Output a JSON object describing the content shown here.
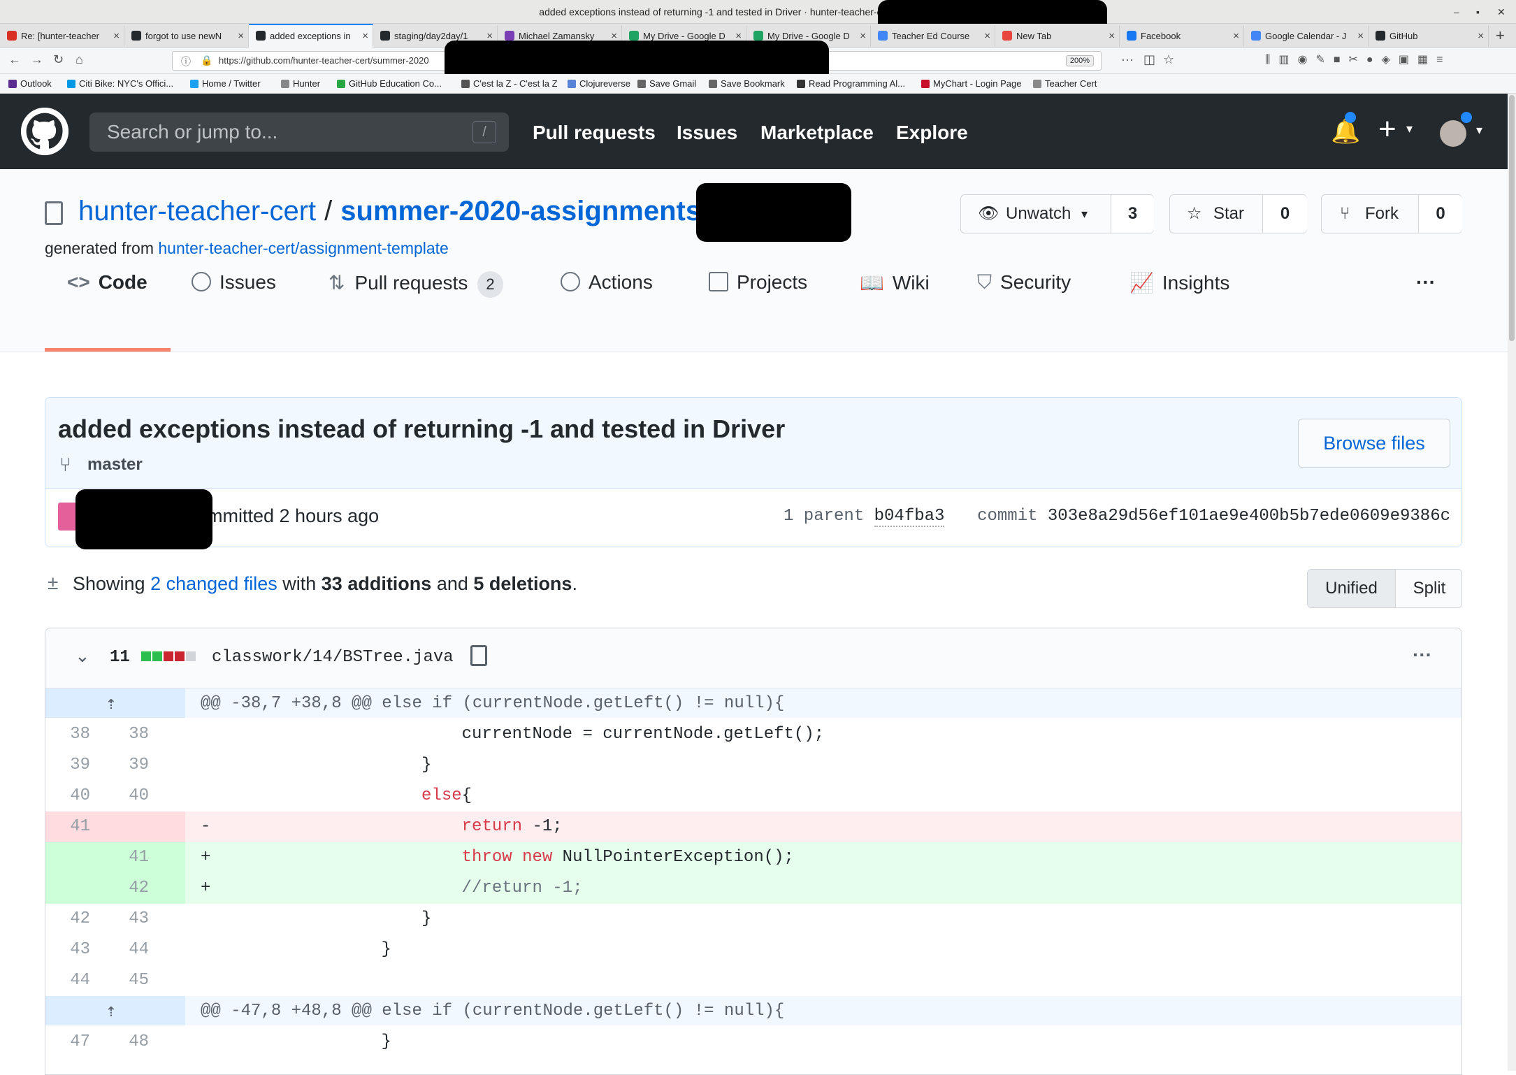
{
  "window": {
    "title": "added exceptions instead of returning -1 and tested in Driver · hunter-teacher-cert/summer-2020-assi"
  },
  "tabs": [
    {
      "label": "Re: [hunter-teacher",
      "icon_color": "#d93025"
    },
    {
      "label": "forgot to use newN",
      "icon_color": "#24292e"
    },
    {
      "label": "added exceptions in",
      "icon_color": "#24292e"
    },
    {
      "label": "staging/day2day/1",
      "icon_color": "#24292e"
    },
    {
      "label": "Michael Zamansky",
      "icon_color": "#7b3fb5"
    },
    {
      "label": "My Drive - Google D",
      "icon_color": "#1fa463"
    },
    {
      "label": "My Drive - Google D",
      "icon_color": "#1fa463"
    },
    {
      "label": "Teacher Ed Course",
      "icon_color": "#4285f4"
    },
    {
      "label": "New Tab",
      "icon_color": "#e8453c"
    },
    {
      "label": "Facebook",
      "icon_color": "#1877f2"
    },
    {
      "label": "Google Calendar - J",
      "icon_color": "#4285f4"
    },
    {
      "label": "GitHub",
      "icon_color": "#24292e"
    }
  ],
  "nav": {
    "url": "https://github.com/hunter-teacher-cert/summer-2020",
    "zoom": "200%"
  },
  "bookmarks": [
    {
      "label": "Outlook",
      "color": "#5c2d91"
    },
    {
      "label": "Citi Bike: NYC's Offici...",
      "color": "#0099e5"
    },
    {
      "label": "Home / Twitter",
      "color": "#1da1f2"
    },
    {
      "label": "Hunter",
      "color": "#888888"
    },
    {
      "label": "GitHub Education Co...",
      "color": "#28a745"
    },
    {
      "label": "C'est la Z - C'est la Z",
      "color": "#555555"
    },
    {
      "label": "Clojureverse",
      "color": "#5881d8"
    },
    {
      "label": "Save Gmail",
      "color": "#666666"
    },
    {
      "label": "Save Bookmark",
      "color": "#666666"
    },
    {
      "label": "Read Programming Al...",
      "color": "#333333"
    },
    {
      "label": "MyChart - Login Page",
      "color": "#c8102e"
    },
    {
      "label": "Teacher Cert",
      "color": "#888888"
    }
  ],
  "gh": {
    "search_placeholder": "Search or jump to...",
    "slash": "/",
    "nav": [
      "Pull requests",
      "Issues",
      "Marketplace",
      "Explore"
    ]
  },
  "repo": {
    "owner": "hunter-teacher-cert",
    "sep": "/",
    "name": "summer-2020-assignments",
    "generated_prefix": "generated from",
    "generated_link": "hunter-teacher-cert/assignment-template",
    "unwatch": "Unwatch",
    "watch_count": "3",
    "star": "Star",
    "star_count": "0",
    "fork": "Fork",
    "fork_count": "0",
    "tabs": {
      "code": "Code",
      "issues": "Issues",
      "pulls": "Pull requests",
      "pulls_count": "2",
      "actions": "Actions",
      "projects": "Projects",
      "wiki": "Wiki",
      "security": "Security",
      "insights": "Insights",
      "more": "···"
    }
  },
  "commit": {
    "title": "added exceptions instead of returning -1 and tested in Driver",
    "branch": "master",
    "browse": "Browse files",
    "committed": "ommitted 2 hours ago",
    "parent_label": "1 parent",
    "parent_sha": "b04fba3",
    "commit_label": "commit",
    "sha": "303e8a29d56ef101ae9e400b5b7ede0609e9386c"
  },
  "summary": {
    "showing": "Showing",
    "changed": "2 changed files",
    "with": "with",
    "additions": "33 additions",
    "and": "and",
    "deletions": "5 deletions",
    "period": ".",
    "unified": "Unified",
    "split": "Split"
  },
  "file": {
    "count": "11",
    "name": "classwork/14/BSTree.java",
    "more": "···",
    "bar_colors": [
      "#2cbe4e",
      "#2cbe4e",
      "#cb2431",
      "#cb2431",
      "#d1d5da"
    ]
  },
  "diff": {
    "hunk1": "@@ -38,7 +38,8 @@ else if (currentNode.getLeft() != null){",
    "hunk2": "@@ -47,8 +48,8 @@ else if (currentNode.getLeft() != null){",
    "lines": [
      {
        "old": "38",
        "new": "38",
        "sign": "",
        "pre": "                        ",
        "kw": "",
        "text": "currentNode = currentNode.getLeft();"
      },
      {
        "old": "39",
        "new": "39",
        "sign": "",
        "pre": "                    ",
        "kw": "",
        "text": "}"
      },
      {
        "old": "40",
        "new": "40",
        "sign": "",
        "pre": "                    ",
        "kw": "else",
        "text": "{"
      },
      {
        "old": "41",
        "new": "",
        "sign": "-",
        "pre": "                        ",
        "kw": "return",
        "text": " -1;"
      },
      {
        "old": "",
        "new": "41",
        "sign": "+",
        "pre": "                        ",
        "kw": "throw new",
        "text": " NullPointerException();"
      },
      {
        "old": "",
        "new": "42",
        "sign": "+",
        "pre": "                        ",
        "kw": "",
        "text": "//return -1;"
      },
      {
        "old": "42",
        "new": "43",
        "sign": "",
        "pre": "                    ",
        "kw": "",
        "text": "}"
      },
      {
        "old": "43",
        "new": "44",
        "sign": "",
        "pre": "                ",
        "kw": "",
        "text": "}"
      },
      {
        "old": "44",
        "new": "45",
        "sign": "",
        "pre": "",
        "kw": "",
        "text": ""
      },
      {
        "old": "47",
        "new": "48",
        "sign": "",
        "pre": "                ",
        "kw": "",
        "text": "}"
      }
    ]
  }
}
